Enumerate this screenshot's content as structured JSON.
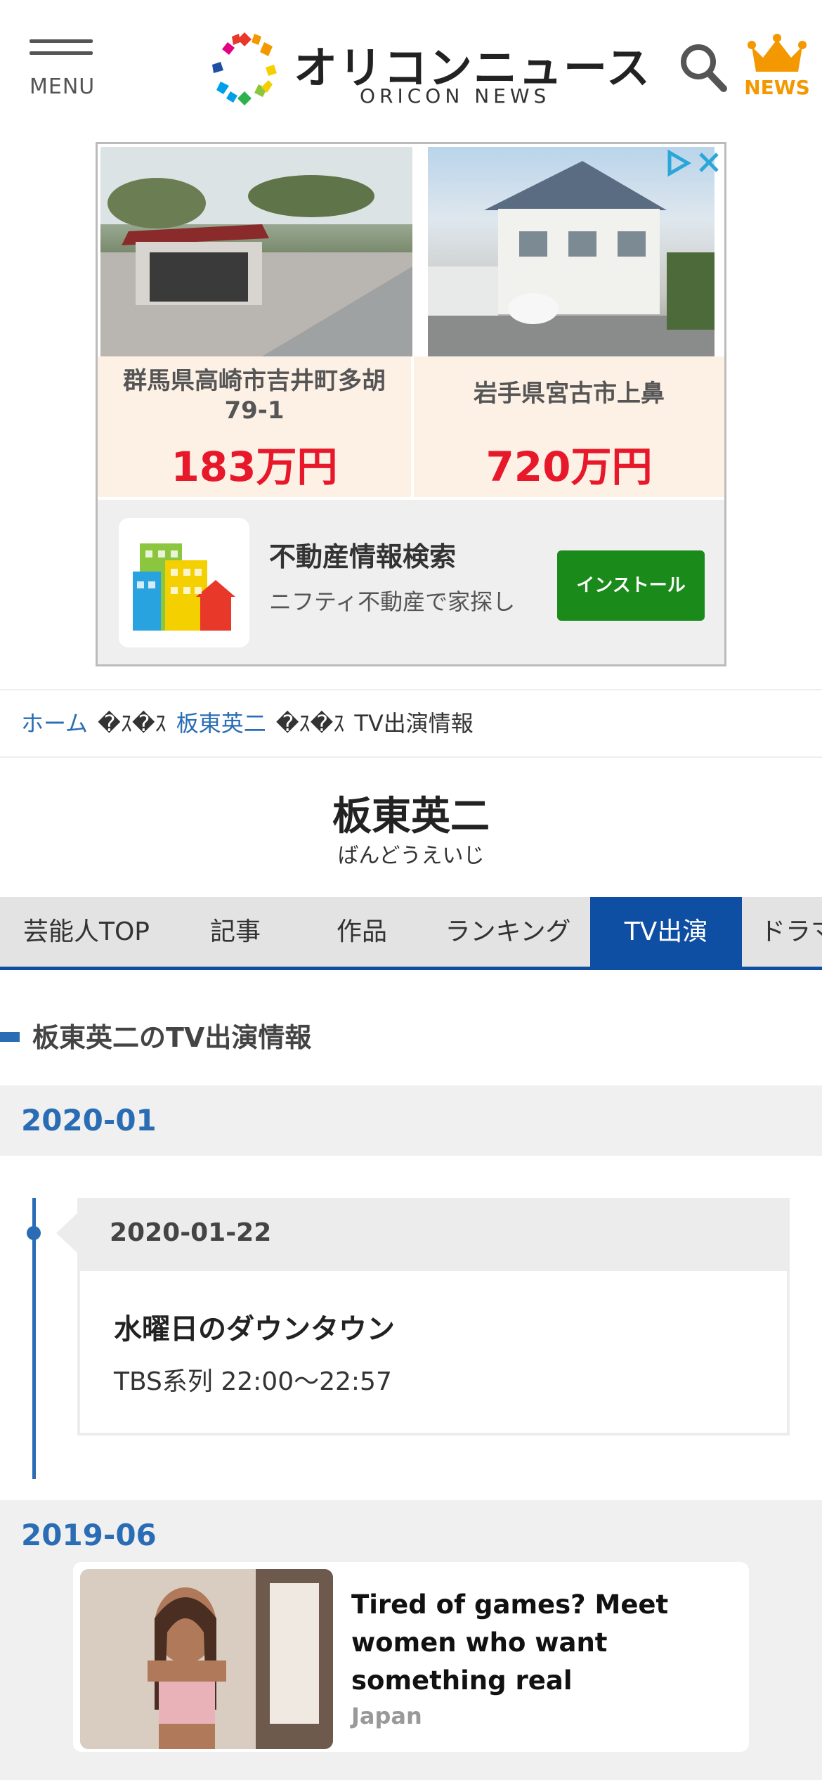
{
  "header": {
    "menu_label": "MENU",
    "logo_title": "オリコンニュース",
    "logo_sub": "ORICON NEWS",
    "news_label": "NEWS",
    "colors": {
      "accent": "#2a6db5",
      "news": "#f39800"
    }
  },
  "ad": {
    "listings": [
      {
        "address": "群馬県高崎市吉井町多胡\n79-1",
        "price": "183万円"
      },
      {
        "address": "岩手県宮古市上鼻",
        "price": "720万円"
      }
    ],
    "app_name": "不動産情報検索",
    "app_desc": "ニフティ不動産で家探し",
    "install_label": "インストール",
    "price_color": "#e8182b"
  },
  "breadcrumb": {
    "home": "ホーム",
    "separator": "�ｽ�ｽ",
    "talent": "板東英二",
    "current": "TV出演情報"
  },
  "talent": {
    "name": "板東英二",
    "kana": "ばんどうえいじ"
  },
  "tabs": [
    {
      "label": "芸能人TOP"
    },
    {
      "label": "記事"
    },
    {
      "label": "作品"
    },
    {
      "label": "ランキング"
    },
    {
      "label": "TV出演"
    },
    {
      "label": "ドラマ"
    }
  ],
  "section": {
    "title": "板東英二のTV出演情報"
  },
  "months": [
    {
      "label": "2020-01"
    },
    {
      "label": "2019-06"
    }
  ],
  "appearances": [
    {
      "date": "2020-01-22",
      "program": "水曜日のダウンタウン",
      "info": "TBS系列 22:00〜22:57"
    }
  ],
  "native_ad": {
    "title": "Tired of games? Meet women who want something real",
    "source": "Japan"
  }
}
